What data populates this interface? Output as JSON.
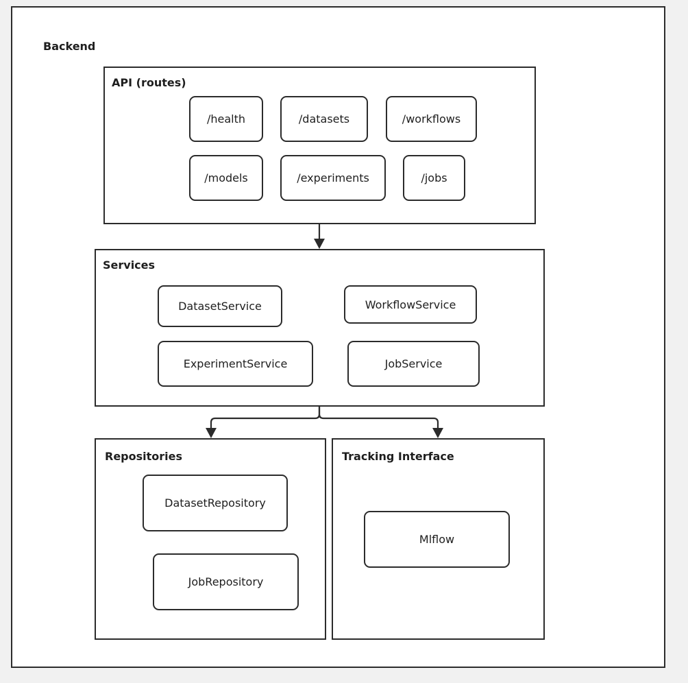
{
  "diagram": {
    "title": "Backend",
    "groups": {
      "api": {
        "label": "API (routes)",
        "nodes": [
          "/health",
          "/datasets",
          "/workflows",
          "/models",
          "/experiments",
          "/jobs"
        ]
      },
      "services": {
        "label": "Services",
        "nodes": [
          "DatasetService",
          "WorkflowService",
          "ExperimentService",
          "JobService"
        ]
      },
      "repositories": {
        "label": "Repositories",
        "nodes": [
          "DatasetRepository",
          "JobRepository"
        ]
      },
      "tracking": {
        "label": "Tracking Interface",
        "nodes": [
          "Mlflow"
        ]
      }
    },
    "edges": [
      {
        "from": "API (routes)",
        "to": "Services"
      },
      {
        "from": "Services",
        "to": "Repositories"
      },
      {
        "from": "Services",
        "to": "Tracking Interface"
      }
    ],
    "colors": {
      "stroke": "#2b2b2b",
      "background": "#f1f1f1",
      "fill": "#ffffff"
    }
  }
}
